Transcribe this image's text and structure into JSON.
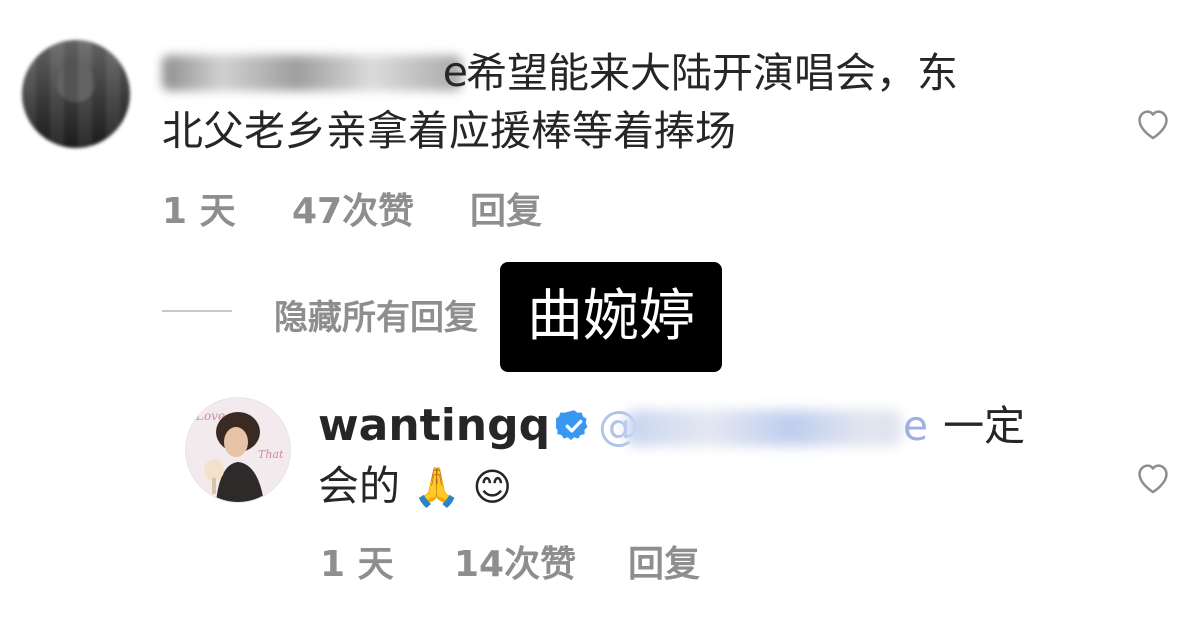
{
  "comment": {
    "username_visible_tail": "e",
    "text_line1": "希望能来大陆开演唱会，东",
    "text_line2": "北父老乡亲拿着应援棒等着捧场",
    "time": "1 天",
    "likes": "47次赞",
    "reply": "回复"
  },
  "thread": {
    "hide_replies": "隐藏所有回复"
  },
  "overlay": {
    "label": "曲婉婷"
  },
  "reply_comment": {
    "username": "wantingq",
    "mention_tail": "e",
    "text_after_mention": "一定",
    "text_line2": "会的",
    "emojis": "🙏 😊",
    "time": "1 天",
    "likes": "14次赞",
    "reply": "回复"
  },
  "colors": {
    "text": "#262626",
    "meta": "#8e8e8e",
    "verified": "#3897f0",
    "mention": "#9fb1e2",
    "overlay_bg": "#000000"
  },
  "icons": {
    "like": "heart-outline-icon",
    "verified": "verified-badge-icon"
  }
}
